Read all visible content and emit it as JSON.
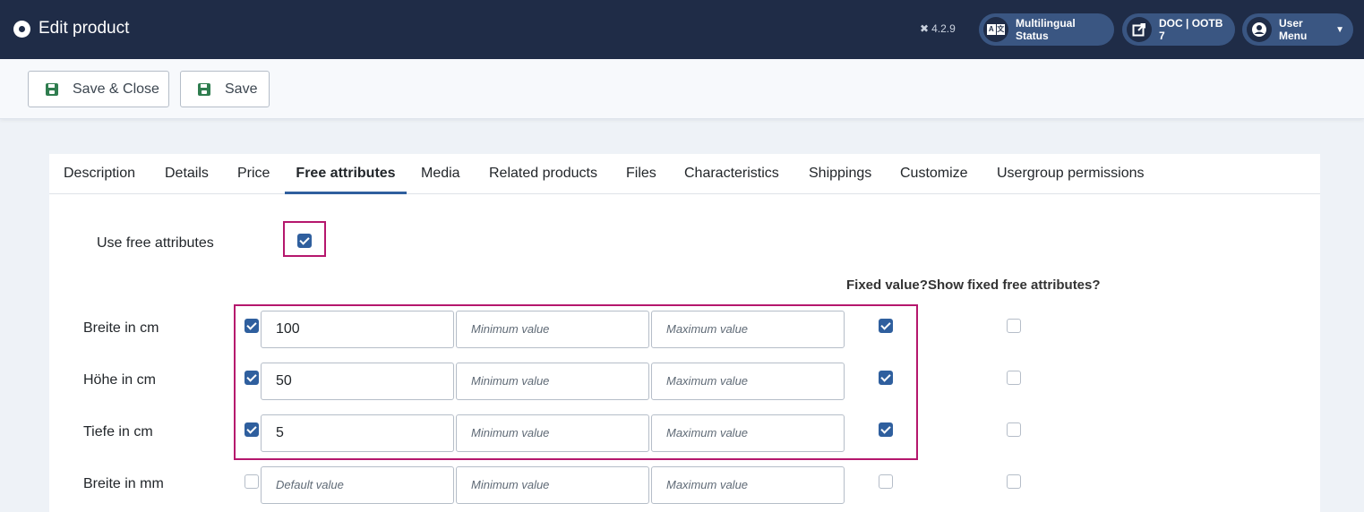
{
  "header": {
    "title": "Edit product",
    "version": "4.2.9",
    "multilingual_label": "Multilingual Status",
    "doc_label": "DOC | OOTB 7",
    "user_menu_label": "User Menu"
  },
  "toolbar": {
    "save_close_label": "Save & Close",
    "save_label": "Save"
  },
  "tabs": [
    {
      "label": "Description"
    },
    {
      "label": "Details"
    },
    {
      "label": "Price"
    },
    {
      "label": "Free attributes",
      "active": true
    },
    {
      "label": "Media"
    },
    {
      "label": "Related products"
    },
    {
      "label": "Files"
    },
    {
      "label": "Characteristics"
    },
    {
      "label": "Shippings"
    },
    {
      "label": "Customize"
    },
    {
      "label": "Usergroup permissions"
    }
  ],
  "form": {
    "use_free_attributes_label": "Use free attributes",
    "use_free_attributes_checked": true,
    "col_fixed_value": "Fixed value?",
    "col_show_fixed": "Show fixed free attributes?",
    "placeholders": {
      "default": "Default value",
      "minimum": "Minimum value",
      "maximum": "Maximum value"
    },
    "rows": [
      {
        "label": "Breite in cm",
        "enabled": true,
        "default": "100",
        "min": "",
        "max": "",
        "fixed": true,
        "show_fixed": false
      },
      {
        "label": "Höhe in cm",
        "enabled": true,
        "default": "50",
        "min": "",
        "max": "",
        "fixed": true,
        "show_fixed": false
      },
      {
        "label": "Tiefe in cm",
        "enabled": true,
        "default": "5",
        "min": "",
        "max": "",
        "fixed": true,
        "show_fixed": false
      },
      {
        "label": "Breite in mm",
        "enabled": false,
        "default": "",
        "min": "",
        "max": "",
        "fixed": false,
        "show_fixed": false
      }
    ]
  },
  "colors": {
    "header_bg": "#1f2c47",
    "accent": "#2f5f9e",
    "highlight": "#b5176d",
    "save_icon": "#2f7d4f"
  }
}
